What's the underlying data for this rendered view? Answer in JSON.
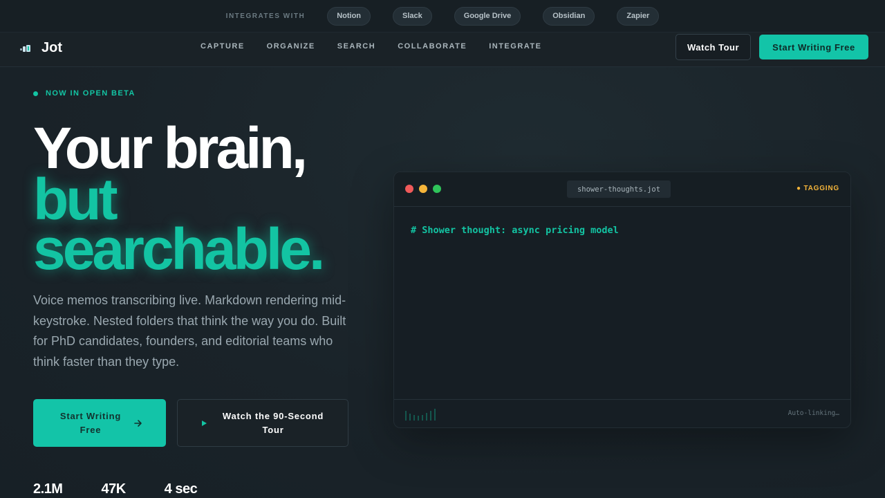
{
  "integrations": {
    "label": "INTEGRATES WITH",
    "items": [
      "Notion",
      "Slack",
      "Google Drive",
      "Obsidian",
      "Zapier"
    ]
  },
  "nav": {
    "brand": "Jot",
    "links": [
      "CAPTURE",
      "ORGANIZE",
      "SEARCH",
      "COLLABORATE",
      "INTEGRATE"
    ],
    "watch_tour": "Watch Tour",
    "start_writing": "Start Writing Free"
  },
  "hero": {
    "badge": "NOW IN OPEN BETA",
    "headline_1": "Your brain,",
    "headline_2": "but",
    "headline_3": "searchable.",
    "description": "Voice memos transcribing live. Markdown rendering mid-keystroke. Nested folders that think the way you do. Built for PhD candidates, founders, and editorial teams who think faster than they type.",
    "cta_primary": "Start Writing Free",
    "cta_secondary": "Watch the 90-Second Tour",
    "stats": [
      "2.1M",
      "47K",
      "4 sec"
    ]
  },
  "editor": {
    "filename": "shower-thoughts.jot",
    "status": "● TAGGING",
    "line_1": "# Shower thought: async pricing model",
    "footer_status": "Auto-linking…"
  },
  "colors": {
    "accent": "#13c4a3",
    "warning": "#f5b53a",
    "background": "#1a2329"
  }
}
